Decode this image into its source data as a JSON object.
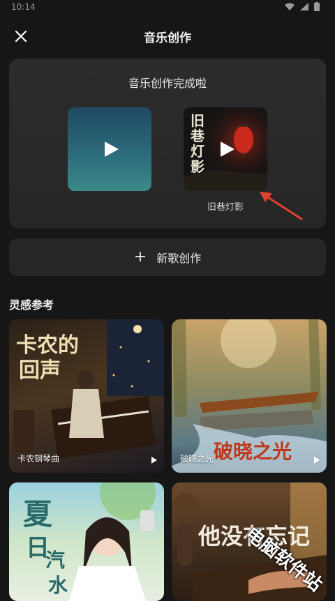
{
  "status_bar": {
    "time": "10:14"
  },
  "header": {
    "title": "音乐创作"
  },
  "done_card": {
    "title": "音乐创作完成啦",
    "songs": [
      {
        "label": ""
      },
      {
        "label": "旧巷灯影",
        "cover_text": "旧巷灯影"
      }
    ]
  },
  "new_song": {
    "label": "新歌创作"
  },
  "inspiration": {
    "title": "灵感参考",
    "cards": [
      {
        "caption": "卡农钢琴曲",
        "art_text_1": "卡农的",
        "art_text_2": "回声"
      },
      {
        "caption": "破晓之光",
        "art_text": "破晓之光"
      },
      {
        "caption": "",
        "art_text_1": "夏",
        "art_text_2": "日",
        "art_text_3": "汽",
        "art_text_4": "水"
      },
      {
        "caption": "",
        "art_text": "他没有忘记"
      }
    ]
  },
  "watermark": "电脑软件站",
  "colors": {
    "background": "#161616",
    "card": "#2a2a2a",
    "arrow": "#e0442e"
  }
}
